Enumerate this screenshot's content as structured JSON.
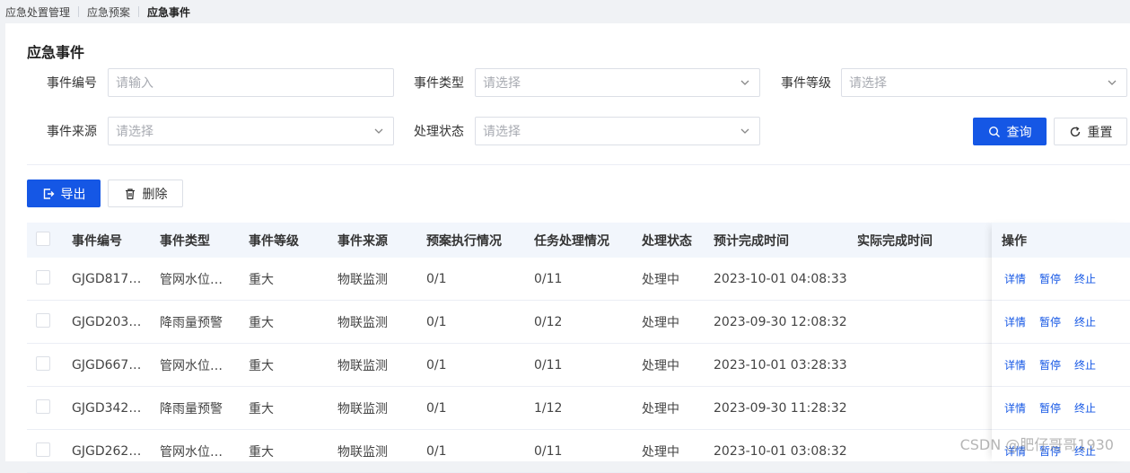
{
  "breadcrumb": [
    "应急处置管理",
    "应急预案",
    "应急事件"
  ],
  "page_title": "应急事件",
  "filters": {
    "event_no": {
      "label": "事件编号",
      "placeholder": "请输入"
    },
    "event_type": {
      "label": "事件类型",
      "placeholder": "请选择"
    },
    "event_level": {
      "label": "事件等级",
      "placeholder": "请选择"
    },
    "event_source": {
      "label": "事件来源",
      "placeholder": "请选择"
    },
    "status": {
      "label": "处理状态",
      "placeholder": "请选择"
    }
  },
  "actions": {
    "query": "查询",
    "reset": "重置",
    "export": "导出",
    "delete": "删除"
  },
  "table": {
    "columns": [
      "事件编号",
      "事件类型",
      "事件等级",
      "事件来源",
      "预案执行情况",
      "任务处理情况",
      "处理状态",
      "预计完成时间",
      "实际完成时间",
      "操作"
    ],
    "row_actions": [
      "详情",
      "暂停",
      "终止"
    ],
    "rows": [
      [
        "GJGD817…",
        "管网水位…",
        "重大",
        "物联监测",
        "0/1",
        "0/11",
        "处理中",
        "2023-10-01 04:08:33",
        ""
      ],
      [
        "GJGD203…",
        "降雨量预警",
        "重大",
        "物联监测",
        "0/1",
        "0/12",
        "处理中",
        "2023-09-30 12:08:32",
        ""
      ],
      [
        "GJGD667…",
        "管网水位…",
        "重大",
        "物联监测",
        "0/1",
        "0/11",
        "处理中",
        "2023-10-01 03:28:33",
        ""
      ],
      [
        "GJGD342…",
        "降雨量预警",
        "重大",
        "物联监测",
        "0/1",
        "1/12",
        "处理中",
        "2023-09-30 11:28:32",
        ""
      ],
      [
        "GJGD262…",
        "管网水位…",
        "重大",
        "物联监测",
        "0/1",
        "0/11",
        "处理中",
        "2023-10-01 03:08:32",
        ""
      ]
    ]
  },
  "watermark": "CSDN @肥仔哥哥1930",
  "colors": {
    "primary": "#1557e5",
    "header_bg": "#f2f6fc",
    "border": "#dcdfe6"
  }
}
